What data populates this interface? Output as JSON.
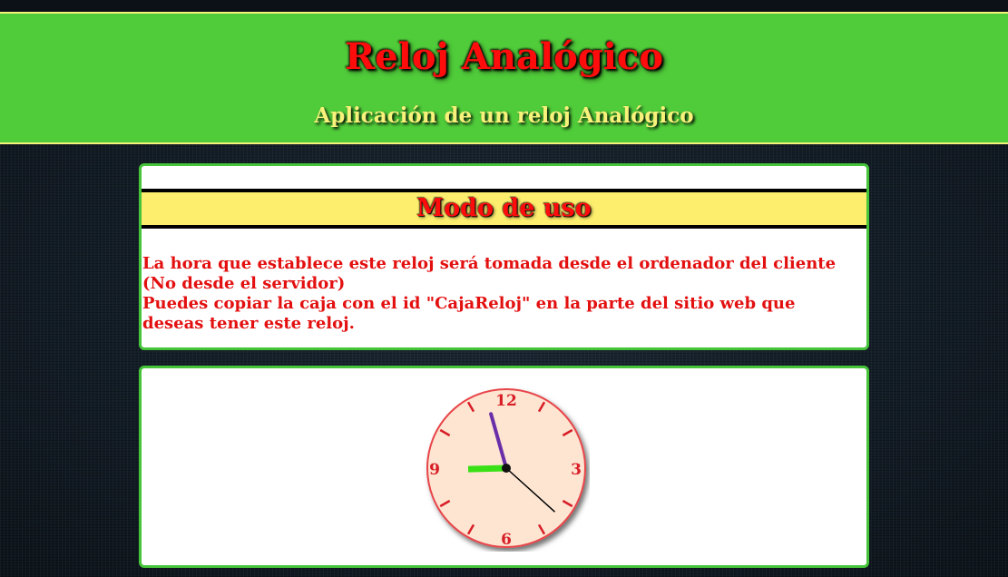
{
  "colors": {
    "header_bg": "#50cc3a",
    "title_text": "#ff0d0d",
    "subtitle_text": "#f8f27a",
    "usage_band_bg": "#fdee6e",
    "usage_text": "#e31010",
    "clock_face": "#fde5d2",
    "clock_rim": "#e8454a",
    "clock_marks": "#d81d26",
    "hour_hand": "#39e015",
    "minute_hand": "#6a2ea8",
    "second_hand": "#000000"
  },
  "header": {
    "title": "Reloj Analógico",
    "subtitle": "Aplicación de un reloj Analógico"
  },
  "usage": {
    "heading": "Modo de uso",
    "paragraph_1": "La hora que establece este reloj será tomada desde el ordenador del cliente (No desde el servidor)",
    "paragraph_2": "Puedes copiar la caja con el id \"CajaReloj\" en la parte del sitio web que deseas tener este reloj."
  },
  "clock": {
    "numerals": {
      "twelve": "12",
      "three": "3",
      "six": "6",
      "nine": "9"
    },
    "time": {
      "hours": 8,
      "minutes": 57,
      "seconds": 22
    }
  }
}
